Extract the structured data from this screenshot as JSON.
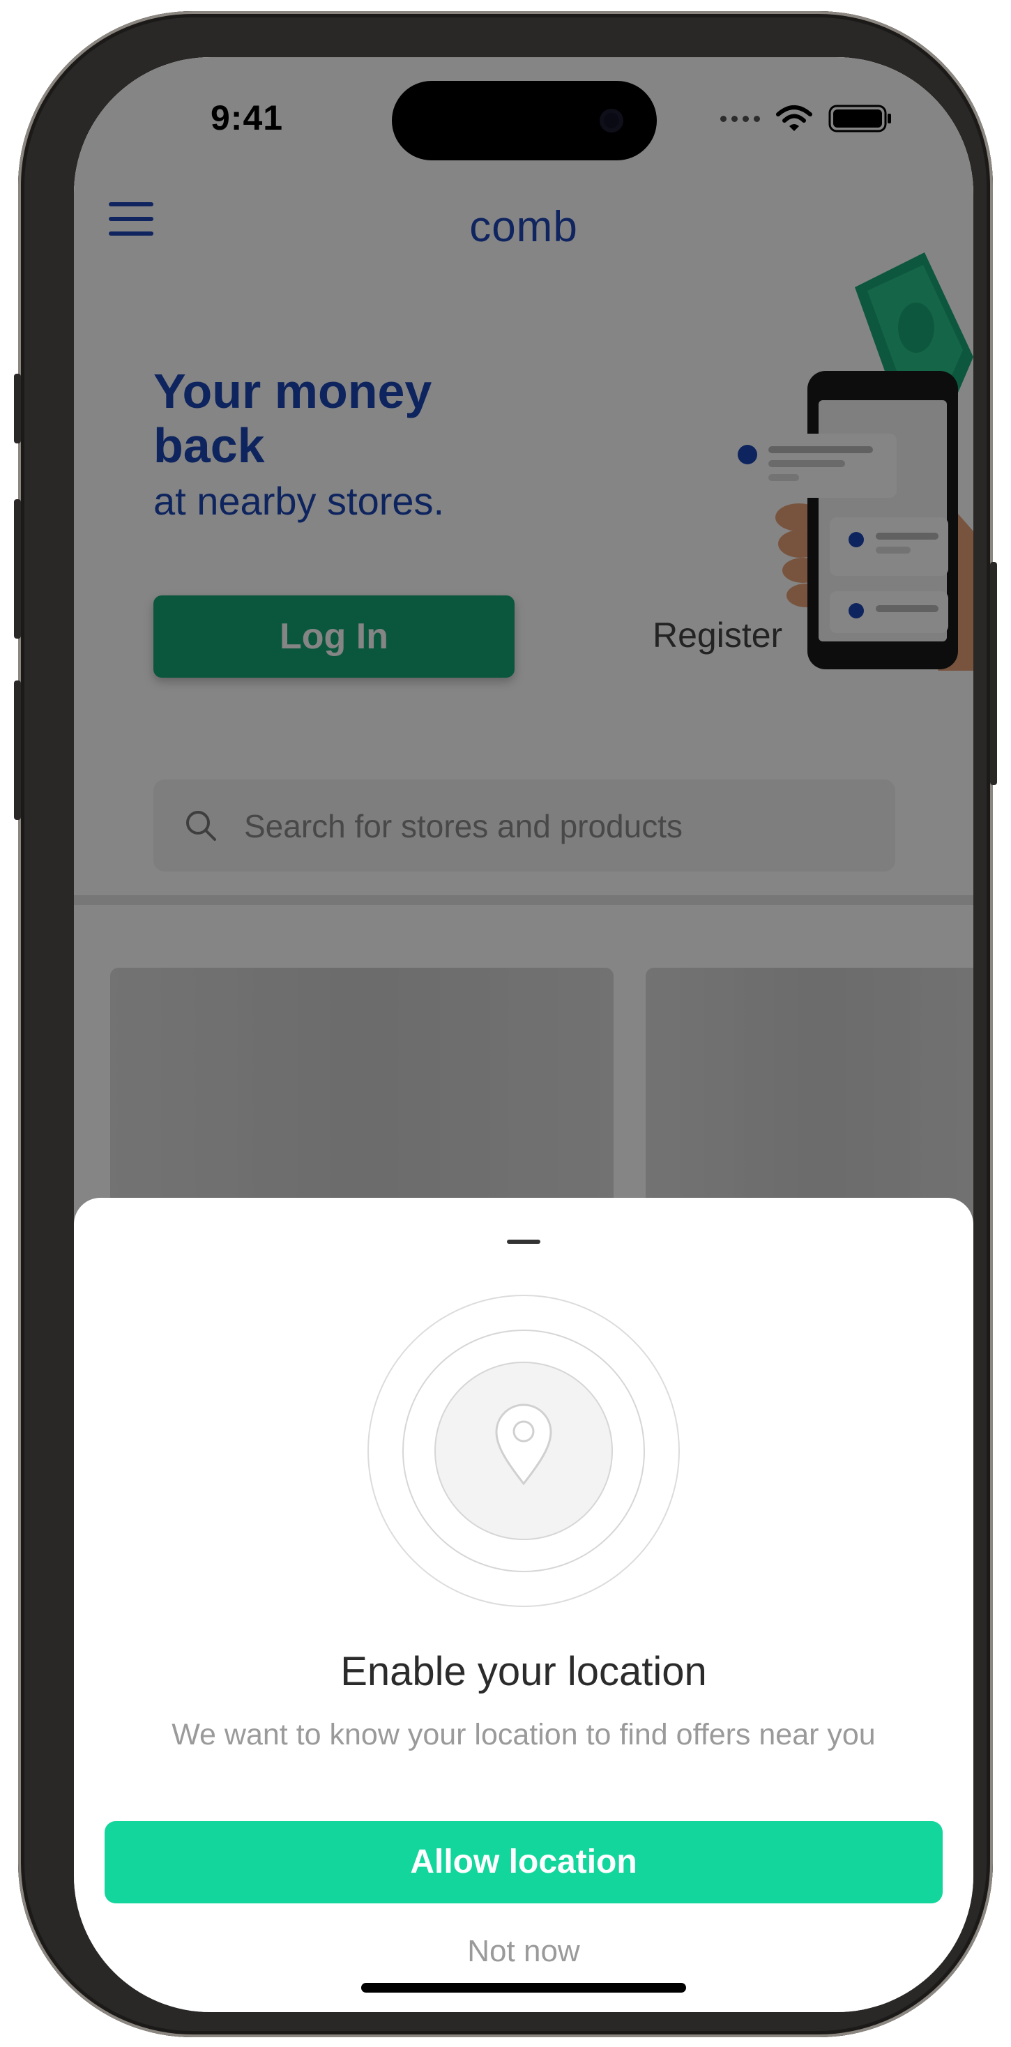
{
  "status_bar": {
    "time": "9:41"
  },
  "header": {
    "logo_text": "comb",
    "menu_icon": "hamburger-menu-icon"
  },
  "hero": {
    "title_line1": "Your money",
    "title_line2": "back",
    "subtitle": "at nearby stores.",
    "login_label": "Log In",
    "register_label": "Register"
  },
  "search": {
    "placeholder": "Search for stores and products",
    "icon": "search-icon"
  },
  "location_sheet": {
    "icon": "location-pin-icon",
    "title": "Enable your location",
    "description": "We want to know your location to find offers near you",
    "allow_label": "Allow location",
    "dismiss_label": "Not now"
  },
  "colors": {
    "brand_blue": "#1c45b4",
    "login_green": "#16a776",
    "allow_green": "#12d69c",
    "overlay": "rgba(0,0,0,0.48)"
  }
}
